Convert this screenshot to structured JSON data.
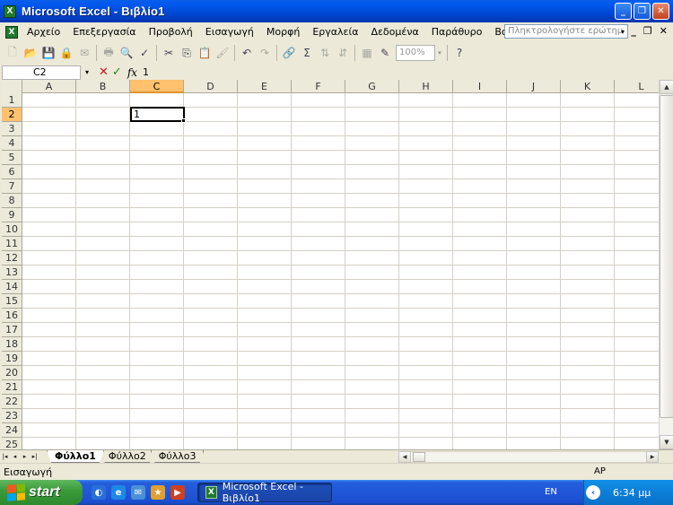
{
  "window": {
    "title": "Microsoft Excel - Βιβλίο1",
    "app_icon_letter": "X",
    "minimize_glyph": "_",
    "maximize_glyph": "❐",
    "close_glyph": "✕"
  },
  "menubar": {
    "items": [
      {
        "label": "Αρχείο"
      },
      {
        "label": "Επεξεργασία"
      },
      {
        "label": "Προβολή"
      },
      {
        "label": "Εισαγωγή"
      },
      {
        "label": "Μορφή"
      },
      {
        "label": "Εργαλεία"
      },
      {
        "label": "Δεδομένα"
      },
      {
        "label": "Παράθυρο"
      },
      {
        "label": "Βοήθεια"
      }
    ],
    "help_placeholder": "Πληκτρολογήστε ερώτημ",
    "doc_minimize_glyph": "_",
    "doc_restore_glyph": "❐",
    "doc_close_glyph": "✕"
  },
  "toolbar": {
    "icons": [
      {
        "name": "new-icon",
        "glyph": "🗋"
      },
      {
        "name": "open-icon",
        "glyph": "📂"
      },
      {
        "name": "save-icon",
        "glyph": "💾"
      },
      {
        "name": "permission-icon",
        "glyph": "🔒"
      },
      {
        "name": "mail-icon",
        "glyph": "✉"
      },
      {
        "name": "print-icon",
        "glyph": "🖶"
      },
      {
        "name": "print-preview-icon",
        "glyph": "🔍"
      },
      {
        "name": "spelling-icon",
        "glyph": "✓"
      },
      {
        "name": "cut-icon",
        "glyph": "✂"
      },
      {
        "name": "copy-icon",
        "glyph": "⎘"
      },
      {
        "name": "paste-icon",
        "glyph": "📋"
      },
      {
        "name": "format-painter-icon",
        "glyph": "🖌"
      },
      {
        "name": "undo-icon",
        "glyph": "↶"
      },
      {
        "name": "redo-icon",
        "glyph": "↷"
      },
      {
        "name": "hyperlink-icon",
        "glyph": "🔗"
      },
      {
        "name": "autosum-icon",
        "glyph": "Σ"
      },
      {
        "name": "sort-asc-icon",
        "glyph": "⇅"
      },
      {
        "name": "sort-desc-icon",
        "glyph": "⇵"
      },
      {
        "name": "chart-icon",
        "glyph": "▦"
      },
      {
        "name": "drawing-icon",
        "glyph": "✎"
      },
      {
        "name": "help-icon",
        "glyph": "?"
      }
    ],
    "zoom_value": "100%",
    "dropdown_glyph": "▾"
  },
  "formula_bar": {
    "name_box": "C2",
    "cancel_glyph": "✕",
    "enter_glyph": "✓",
    "fx_label": "fx",
    "formula_value": "1"
  },
  "grid": {
    "columns": [
      "A",
      "B",
      "C",
      "D",
      "E",
      "F",
      "G",
      "H",
      "I",
      "J",
      "K",
      "L"
    ],
    "rows": [
      "1",
      "2",
      "3",
      "4",
      "5",
      "6",
      "7",
      "8",
      "9",
      "10",
      "11",
      "12",
      "13",
      "14",
      "15",
      "16",
      "17",
      "18",
      "19",
      "20",
      "21",
      "22",
      "23",
      "24",
      "25"
    ],
    "active_column": "C",
    "active_row": "2",
    "active_cell_value": "1"
  },
  "sheet_tabs": {
    "nav": [
      "|◂",
      "◂",
      "▸",
      "▸|"
    ],
    "tabs": [
      {
        "label": "Φύλλο1",
        "active": true
      },
      {
        "label": "Φύλλο2",
        "active": false
      },
      {
        "label": "Φύλλο3",
        "active": false
      }
    ]
  },
  "status_bar": {
    "mode": "Εισαγωγή",
    "indicator": "ΑΡ"
  },
  "taskbar": {
    "start_label": "start",
    "task_label": "Microsoft Excel - Βιβλίο1",
    "language": "EN",
    "clock": "6:34 μμ"
  },
  "colors": {
    "titlebar": "#0058EE",
    "active_header": "#FFC16E",
    "start_button": "#3B9B3B"
  }
}
